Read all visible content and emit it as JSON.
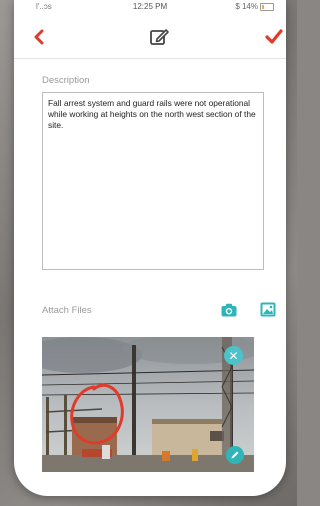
{
  "status_bar": {
    "carrier": "l'..ɔs",
    "time": "12:25 PM",
    "battery": "$ 14%"
  },
  "toolbar": {
    "back_icon": "chevron-left-icon",
    "edit_icon": "edit-note-icon",
    "save_icon": "checkmark-icon"
  },
  "form": {
    "description_label": "Description",
    "description_value": "Fall arrest system and guard rails were not operational while working at heights on the north west section of the site.",
    "attach_label": "Attach Files"
  },
  "attachments": {
    "remove_icon": "close-icon",
    "remove_glyph": "✕",
    "edit_icon": "pencil-icon"
  },
  "colors": {
    "accent_red": "#e03b2a",
    "accent_teal": "#2eb5b9"
  }
}
